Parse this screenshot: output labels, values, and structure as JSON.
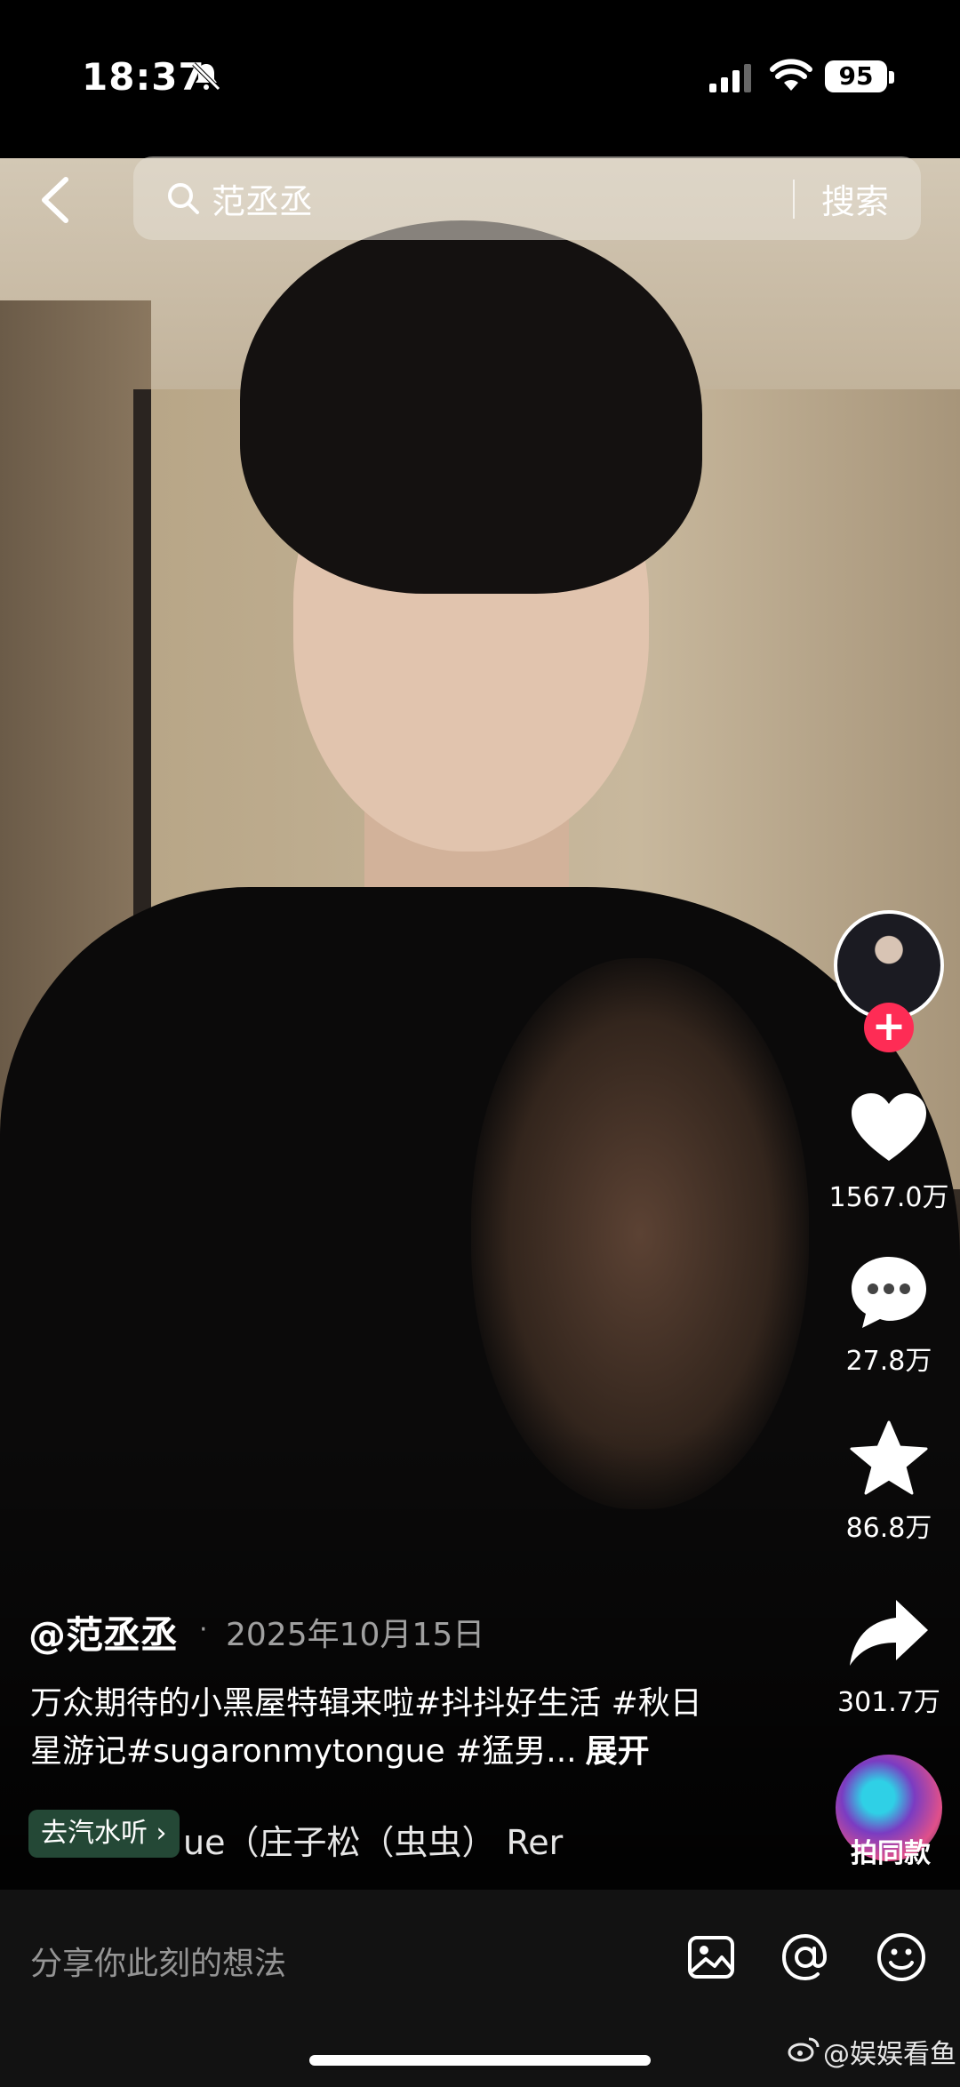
{
  "status_bar": {
    "time": "18:37",
    "battery": "95"
  },
  "search": {
    "query": "范丞丞",
    "button_label": "搜索"
  },
  "rail": {
    "likes": "1567.0万",
    "comments": "27.8万",
    "favorites": "86.8万",
    "shares": "301.7万",
    "music_label": "拍同款"
  },
  "post": {
    "author": "@范丞丞",
    "date": "2025年10月15日",
    "caption": "万众期待的小黑屋特辑来啦#抖抖好生活 #秋日星游记#sugaronmytongue #猛男...",
    "more_label": "展开"
  },
  "music": {
    "listen_label": "去汽水听",
    "track": "ue（庄子松（虫虫） Rer"
  },
  "comment": {
    "placeholder": "分享你此刻的想法"
  },
  "watermark": "@娱娱看鱼",
  "colors": {
    "follow": "#fe2c55",
    "comment_bar": "#121212"
  }
}
